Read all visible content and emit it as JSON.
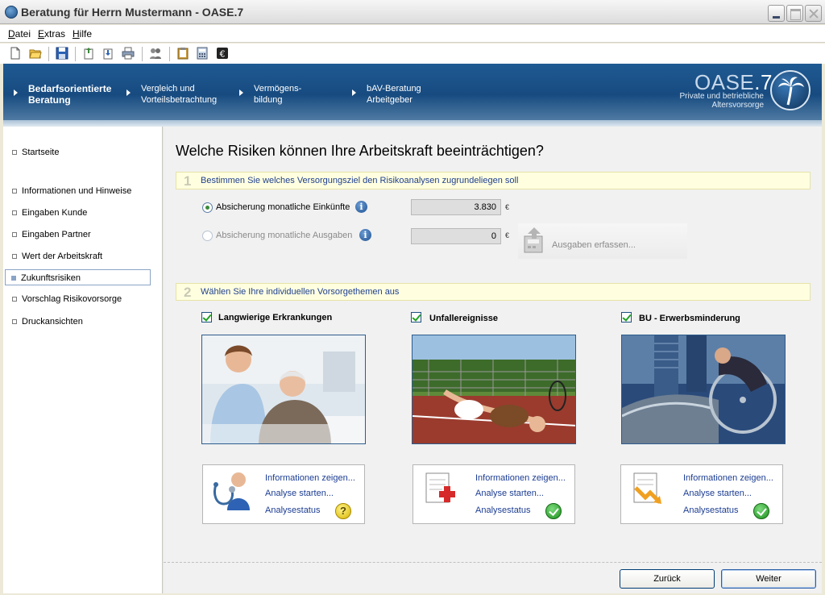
{
  "window": {
    "title": "Beratung für Herrn Mustermann - OASE.7"
  },
  "menu": {
    "items": [
      "Datei",
      "Extras",
      "Hilfe"
    ]
  },
  "toolbar": {
    "icons": [
      "new-document-icon",
      "open-folder-icon",
      "save-icon",
      "export-icon",
      "import-icon",
      "print-icon",
      "users-icon",
      "clipboard-icon",
      "calculator-icon",
      "euro-icon"
    ]
  },
  "header": {
    "steps": [
      {
        "line1": "Bedarfsorientierte",
        "line2": "Beratung"
      },
      {
        "line1": "Vergleich und",
        "line2": "Vorteilsbetrachtung"
      },
      {
        "line1": "Vermögens-",
        "line2": "bildung"
      },
      {
        "line1": "bAV-Beratung",
        "line2": "Arbeitgeber"
      }
    ],
    "logo_name": "OASE",
    "logo_version": ".7",
    "logo_sub1": "Private und betriebliche",
    "logo_sub2": "Altersvorsorge"
  },
  "sidebar": {
    "items": [
      {
        "label": "Startseite"
      },
      {
        "label": "Informationen und Hinweise"
      },
      {
        "label": "Eingaben Kunde"
      },
      {
        "label": "Eingaben Partner"
      },
      {
        "label": "Wert der Arbeitskraft"
      },
      {
        "label": "Zukunftsrisiken"
      },
      {
        "label": "Vorschlag Risikovorsorge"
      },
      {
        "label": "Druckansichten"
      }
    ]
  },
  "main": {
    "title": "Welche Risiken können Ihre Arbeitskraft beeinträchtigen?",
    "section1": {
      "num": "1",
      "text": "Bestimmen Sie welches Versorgungsziel den Risikoanalysen zugrundeliegen soll",
      "option1": {
        "label": "Absicherung monatliche Einkünfte",
        "value": "3.830",
        "unit": "€"
      },
      "option2": {
        "label": "Absicherung monatliche Ausgaben",
        "value": "0",
        "unit": "€"
      },
      "expense_button": "Ausgaben erfassen..."
    },
    "section2": {
      "num": "2",
      "text": "Wählen Sie Ihre individuellen Vorsorgethemen aus",
      "themes": [
        {
          "label": "Langwierige Erkrankungen"
        },
        {
          "label": "Unfallereignisse"
        },
        {
          "label": "BU - Erwerbsminderung"
        }
      ]
    },
    "panel_links": {
      "info": "Informationen zeigen...",
      "analyse": "Analyse starten...",
      "status": "Analysestatus"
    },
    "statuses": [
      "?",
      "ok",
      "ok"
    ]
  },
  "footer": {
    "back": "Zurück",
    "next": "Weiter"
  }
}
